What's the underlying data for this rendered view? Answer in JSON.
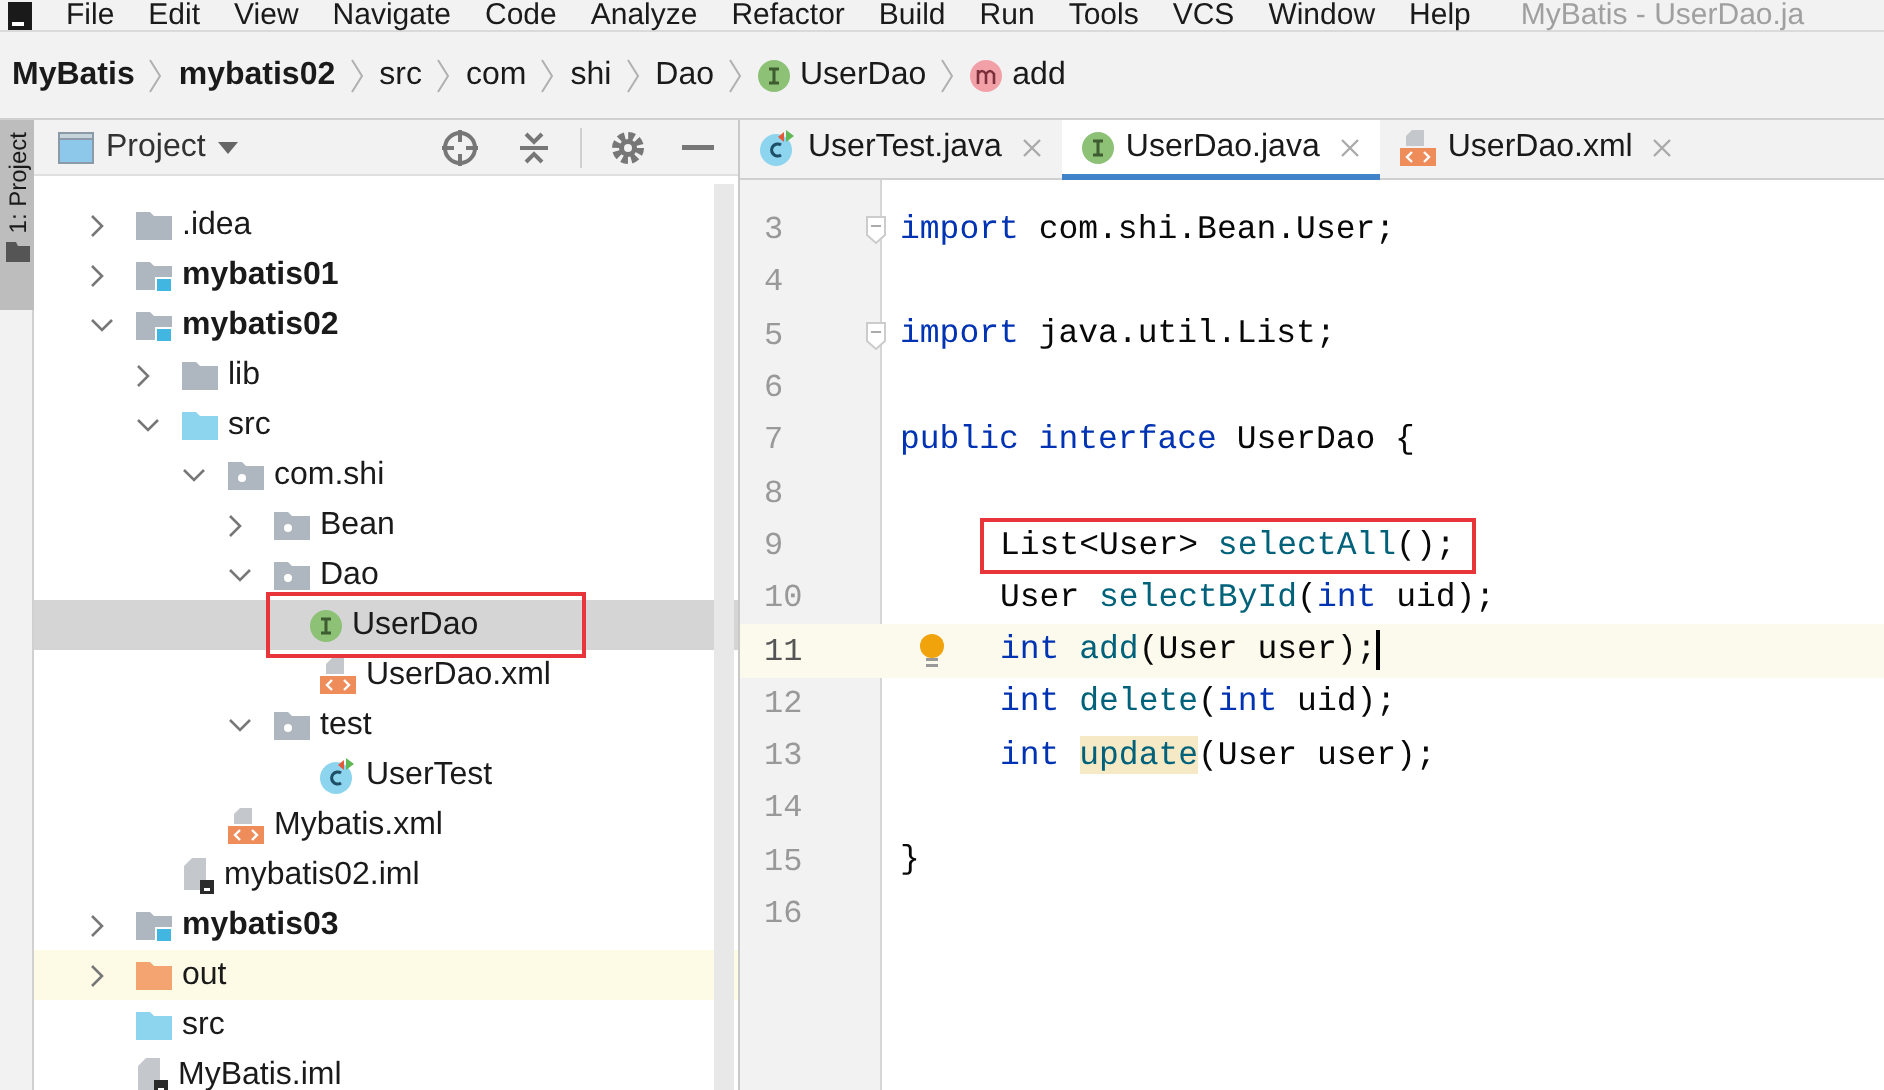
{
  "menu": [
    "File",
    "Edit",
    "View",
    "Navigate",
    "Code",
    "Analyze",
    "Refactor",
    "Build",
    "Run",
    "Tools",
    "VCS",
    "Window",
    "Help"
  ],
  "window": {
    "title": "MyBatis - UserDao.ja"
  },
  "breadcrumb": [
    {
      "label": "MyBatis",
      "kind": "project"
    },
    {
      "label": "mybatis02",
      "kind": "project"
    },
    {
      "label": "src",
      "kind": "plain"
    },
    {
      "label": "com",
      "kind": "plain"
    },
    {
      "label": "shi",
      "kind": "plain"
    },
    {
      "label": "Dao",
      "kind": "plain"
    },
    {
      "label": "UserDao",
      "kind": "interface"
    },
    {
      "label": "add",
      "kind": "method"
    }
  ],
  "side_tab": {
    "label": "1: Project",
    "selected": true
  },
  "project_panel": {
    "title": "Project",
    "tree": [
      {
        "label": ".idea",
        "kind": "folder",
        "expanded": false,
        "selected": false
      },
      {
        "label": "mybatis01",
        "kind": "module",
        "expanded": false,
        "selected": false
      },
      {
        "label": "mybatis02",
        "kind": "module",
        "expanded": true,
        "selected": false,
        "children": [
          {
            "label": "lib",
            "kind": "folder",
            "expanded": false,
            "selected": false
          },
          {
            "label": "src",
            "kind": "source",
            "expanded": true,
            "selected": false,
            "children": [
              {
                "label": "com.shi",
                "kind": "package",
                "expanded": true,
                "selected": false,
                "children": [
                  {
                    "label": "Bean",
                    "kind": "package",
                    "expanded": false,
                    "selected": false
                  },
                  {
                    "label": "Dao",
                    "kind": "package",
                    "expanded": true,
                    "selected": false,
                    "children": [
                      {
                        "label": "UserDao",
                        "kind": "interface",
                        "selected": true,
                        "annotated": true
                      },
                      {
                        "label": "UserDao.xml",
                        "kind": "xml",
                        "selected": false
                      }
                    ]
                  },
                  {
                    "label": "test",
                    "kind": "package",
                    "expanded": true,
                    "selected": false,
                    "children": [
                      {
                        "label": "UserTest",
                        "kind": "class",
                        "selected": false
                      }
                    ]
                  }
                ]
              },
              {
                "label": "Mybatis.xml",
                "kind": "xml",
                "selected": false
              }
            ]
          },
          {
            "label": "mybatis02.iml",
            "kind": "iml",
            "selected": false
          }
        ]
      },
      {
        "label": "mybatis03",
        "kind": "module",
        "expanded": false,
        "selected": false
      },
      {
        "label": "out",
        "kind": "excluded",
        "expanded": false,
        "selected": false
      },
      {
        "label": "src",
        "kind": "source",
        "selected": false
      },
      {
        "label": "MyBatis.iml",
        "kind": "iml",
        "selected": false
      }
    ]
  },
  "editor": {
    "tabs": [
      {
        "label": "UserTest.java",
        "kind": "class",
        "selected": false
      },
      {
        "label": "UserDao.java",
        "kind": "interface",
        "selected": true
      },
      {
        "label": "UserDao.xml",
        "kind": "xml",
        "selected": false
      }
    ],
    "lines": [
      {
        "number": "3",
        "fold": true,
        "tokens": [
          {
            "text": "import",
            "kind": "keyword"
          },
          {
            "text": " com.shi.Bean.User;",
            "kind": "plain"
          }
        ]
      },
      {
        "number": "4"
      },
      {
        "number": "5",
        "fold": true,
        "tokens": [
          {
            "text": "import",
            "kind": "keyword"
          },
          {
            "text": " java.util.List;",
            "kind": "plain"
          }
        ]
      },
      {
        "number": "6"
      },
      {
        "number": "7",
        "tokens": [
          {
            "text": "public interface",
            "kind": "keyword"
          },
          {
            "text": " UserDao {",
            "kind": "plain"
          }
        ]
      },
      {
        "number": "8"
      },
      {
        "number": "9",
        "indented": true,
        "annotated": true,
        "tokens": [
          {
            "text": "List<User> ",
            "kind": "plain"
          },
          {
            "text": "selectAll",
            "kind": "method"
          },
          {
            "text": "();",
            "kind": "plain"
          }
        ]
      },
      {
        "number": "10",
        "indented": true,
        "tokens": [
          {
            "text": "User ",
            "kind": "plain"
          },
          {
            "text": "selectById",
            "kind": "method"
          },
          {
            "text": "(",
            "kind": "plain"
          },
          {
            "text": "int",
            "kind": "keyword"
          },
          {
            "text": " uid);",
            "kind": "plain"
          }
        ]
      },
      {
        "number": "11",
        "indented": true,
        "current": true,
        "bulb": true,
        "tokens": [
          {
            "text": "int ",
            "kind": "keyword"
          },
          {
            "text": "add",
            "kind": "method"
          },
          {
            "text": "(User user);",
            "kind": "plain"
          }
        ]
      },
      {
        "number": "12",
        "indented": true,
        "tokens": [
          {
            "text": "int ",
            "kind": "keyword"
          },
          {
            "text": "delete",
            "kind": "method"
          },
          {
            "text": "(",
            "kind": "plain"
          },
          {
            "text": "int",
            "kind": "keyword"
          },
          {
            "text": " uid);",
            "kind": "plain"
          }
        ]
      },
      {
        "number": "13",
        "indented": true,
        "tokens": [
          {
            "text": "int ",
            "kind": "keyword"
          },
          {
            "text": "update",
            "kind": "match"
          },
          {
            "text": "(User user);",
            "kind": "plain"
          }
        ]
      },
      {
        "number": "14"
      },
      {
        "number": "15",
        "tokens": [
          {
            "text": "}",
            "kind": "plain"
          }
        ]
      },
      {
        "number": "16"
      }
    ]
  }
}
